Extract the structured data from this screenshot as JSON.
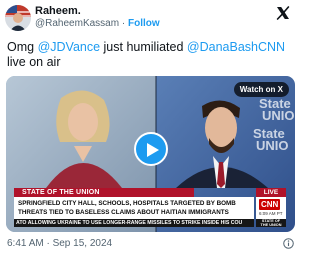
{
  "author": {
    "display_name": "Raheem.",
    "handle": "@RaheemKassam",
    "separator": "·",
    "follow_label": "Follow"
  },
  "tweet": {
    "text_part1": "Omg ",
    "mention1": "@JDVance",
    "text_part2": " just humiliated ",
    "mention2": "@DanaBashCNN",
    "text_part3": " live on air"
  },
  "media": {
    "watch_label": "Watch on X",
    "background_text": [
      "State",
      "UNIO",
      "State",
      "UNIO"
    ],
    "chyron": {
      "program": "STATE OF THE UNION",
      "live_label": "LIVE",
      "headline_line1": "SPRINGFIELD CITY HALL, SCHOOLS, HOSPITALS TARGETED BY BOMB",
      "headline_line2": "THREATS TIED TO BASELESS CLAIMS ABOUT HAITIAN IMMIGRANTS",
      "network": "CNN",
      "clock": "6:09 AM PT",
      "ticker": "ATO ALLOWING UKRAINE TO USE LONGER-RANGE MISSILES TO STRIKE INSIDE HIS COU",
      "show_tag_line1": "STATE OF",
      "show_tag_line2": "THE UNION"
    }
  },
  "meta": {
    "timestamp": "6:41 AM · Sep 15, 2024"
  },
  "colors": {
    "accent": "#1d9bf0",
    "text": "#0f1419",
    "muted": "#536471",
    "cnn_red": "#cc0000"
  },
  "icons": [
    "x-logo-icon",
    "play-icon",
    "info-icon"
  ]
}
